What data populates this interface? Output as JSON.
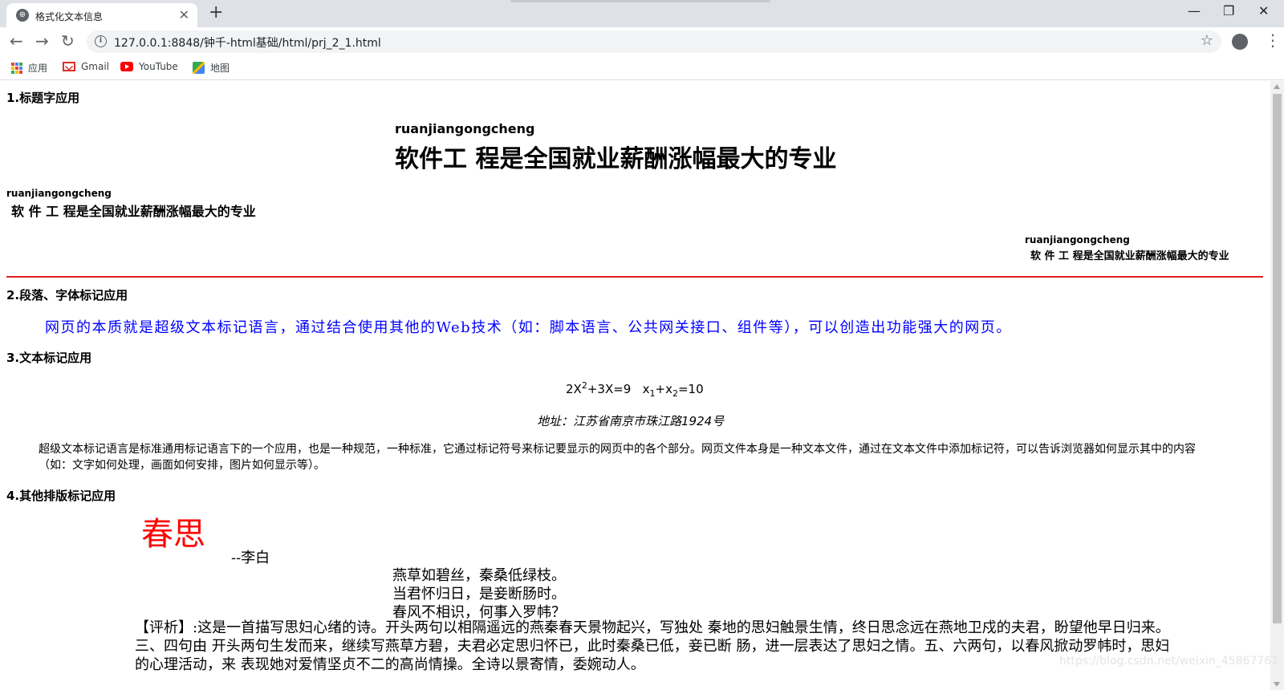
{
  "browser": {
    "tab_title": "格式化文本信息",
    "url": "127.0.0.1:8848/钟千-html基础/html/prj_2_1.html",
    "bookmarks": [
      {
        "label": "应用",
        "icon": "apps-grid-icon"
      },
      {
        "label": "Gmail",
        "icon": "gmail-icon"
      },
      {
        "label": "YouTube",
        "icon": "youtube-icon"
      },
      {
        "label": "地图",
        "icon": "maps-icon"
      }
    ]
  },
  "page": {
    "section1": {
      "title": "1.标题字应用",
      "heading1_sub": "ruanjiangongcheng",
      "heading1_main": "软件工 程是全国就业薪酬涨幅最大的专业",
      "heading2_sub": "ruanjiangongcheng",
      "heading2_main": "软 件 工 程是全国就业薪酬涨幅最大的专业",
      "heading3_sub": "ruanjiangongcheng",
      "heading3_main": "软 件 工 程是全国就业薪酬涨幅最大的专业"
    },
    "section2": {
      "title": "2.段落、字体标记应用",
      "paragraph": "网页的本质就是超级文本标记语言，通过结合使用其他的Web技术（如：脚本语言、公共网关接口、组件等），可以创造出功能强大的网页。",
      "paragraph_color": "#0000ff"
    },
    "section3": {
      "title": "3.文本标记应用",
      "formula_a": "2X",
      "formula_a_sup": "2",
      "formula_b": "+3X=9",
      "formula_c": "x",
      "formula_c_sub": "1",
      "formula_d": "+x",
      "formula_d_sub": "2",
      "formula_e": "=10",
      "address": "地址：江苏省南京市珠江路1924号",
      "paragraph": "超级文本标记语言是标准通用标记语言下的一个应用，也是一种规范，一种标准，它通过标记符号来标记要显示的网页中的各个部分。网页文件本身是一种文本文件，通过在文本文件中添加标记符，可以告诉浏览器如何显示其中的内容（如：文字如何处理，画面如何安排，图片如何显示等）。"
    },
    "section4": {
      "title": "4.其他排版标记应用",
      "poem_title": "春思",
      "poem_title_color": "#ff0000",
      "poem_author": "--李白",
      "poem_lines": [
        "燕草如碧丝，秦桑低绿枝。",
        "当君怀归日，是妾断肠时。",
        "春风不相识，何事入罗帏？"
      ],
      "comment": "【评析】:这是一首描写思妇心绪的诗。开头两句以相隔遥远的燕秦春天景物起兴，写独处 秦地的思妇触景生情，终日思念远在燕地卫戍的夫君，盼望他早日归来。三、四句由 开头两句生发而来，继续写燕草方碧，夫君必定思归怀已，此时秦桑已低，妾已断 肠，进一层表达了思妇之情。五、六两句，以春风掀动罗帏时，思妇的心理活动，来 表现她对爱情坚贞不二的高尚情操。全诗以景寄情，委婉动人。"
    },
    "watermark": "https://blog.csdn.net/weixin_45867761"
  }
}
